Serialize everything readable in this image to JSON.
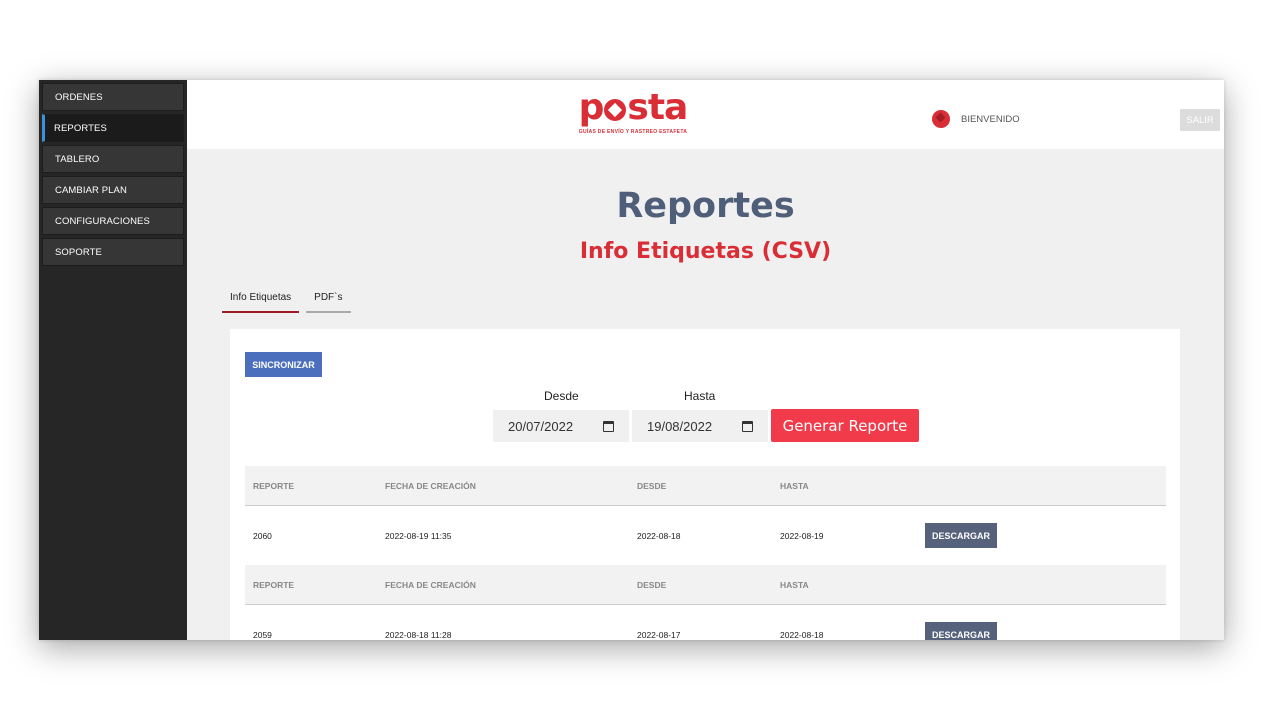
{
  "sidebar": {
    "items": [
      {
        "label": "ORDENES",
        "active": false
      },
      {
        "label": "REPORTES",
        "active": true
      },
      {
        "label": "TABLERO",
        "active": false
      },
      {
        "label": "CAMBIAR PLAN",
        "active": false
      },
      {
        "label": "CONFIGURACIONES",
        "active": false
      },
      {
        "label": "SOPORTE",
        "active": false
      }
    ]
  },
  "header": {
    "logo_text": "posta",
    "logo_tagline": "GUÍAS DE ENVÍO Y RASTREO ESTAFETA",
    "welcome": "BIENVENIDO",
    "logout_label": "SALIR"
  },
  "page": {
    "title": "Reportes",
    "subtitle": "Info Etiquetas (CSV)",
    "tabs": [
      {
        "label": "Info Etiquetas",
        "active": true
      },
      {
        "label": "PDF`s",
        "active": false
      }
    ]
  },
  "filters": {
    "sync_label": "SINCRONIZAR",
    "from_label": "Desde",
    "to_label": "Hasta",
    "from_value": "20/07/2022",
    "to_value": "19/08/2022",
    "generate_label": "Generar Reporte"
  },
  "table": {
    "headers": [
      "REPORTE",
      "FECHA DE CREACIÓN",
      "DESDE",
      "HASTA"
    ],
    "rows": [
      {
        "reporte": "2060",
        "fecha": "2022-08-19 11:35",
        "desde": "2022-08-18",
        "hasta": "2022-08-19",
        "action": "DESCARGAR"
      },
      {
        "reporte": "2059",
        "fecha": "2022-08-18 11:28",
        "desde": "2022-08-17",
        "hasta": "2022-08-18",
        "action": "DESCARGAR"
      }
    ]
  },
  "colors": {
    "brand_red": "#d92e36",
    "title_slate": "#4f5f7a",
    "sidebar_bg": "#262626",
    "sync_blue": "#4b6fbd",
    "generate_red": "#f23b4a",
    "download_slate": "#56617c"
  }
}
